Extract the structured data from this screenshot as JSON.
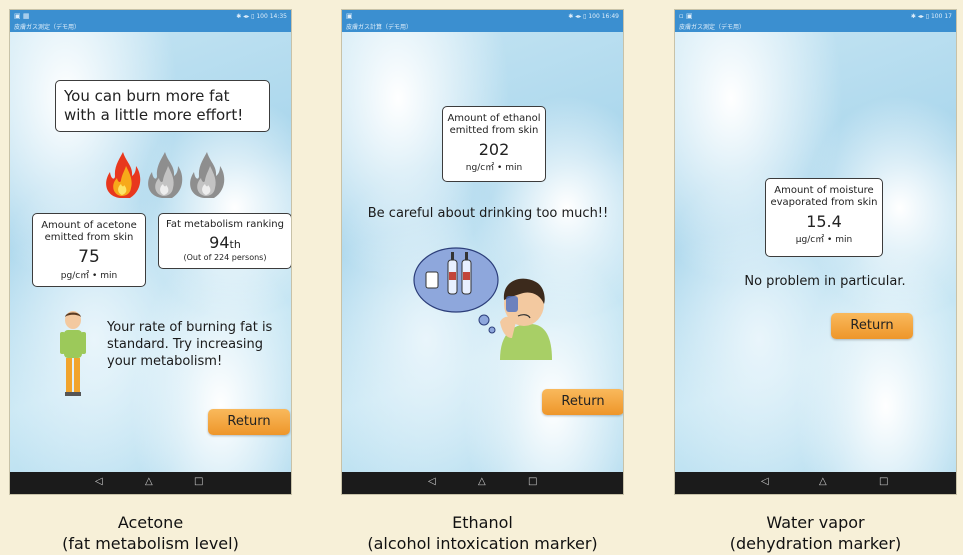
{
  "panels": [
    {
      "statusbar": {
        "time": "14:35",
        "battery": "100",
        "app_title": "皮膚ガス測定（デモ用）"
      },
      "headline": "You can burn more fat with a little more effort!",
      "acetone": {
        "label": "Amount of acetone emitted from skin",
        "value": "75",
        "unit": "pg/c㎡ • min"
      },
      "ranking": {
        "label": "Fat metabolism ranking",
        "value": "94",
        "suffix": "th",
        "note": "(Out of 224 persons)"
      },
      "message": "Your rate of burning fat is standard. Try increasing your metabolism!",
      "return_label": "Return",
      "caption_line1": "Acetone",
      "caption_line2": "(fat metabolism level)"
    },
    {
      "statusbar": {
        "time": "16:49",
        "battery": "100",
        "app_title": "皮膚ガス計算（デモ用）"
      },
      "ethanol": {
        "label": "Amount of ethanol emitted from skin",
        "value": "202",
        "unit": "ng/c㎡ • min"
      },
      "message": "Be careful about drinking too much!!",
      "return_label": "Return",
      "caption_line1": "Ethanol",
      "caption_line2": "(alcohol intoxication marker)"
    },
    {
      "statusbar": {
        "time": "17",
        "battery": "100",
        "app_title": "皮膚ガス測定（デモ用）"
      },
      "moisture": {
        "label": "Amount of moisture evaporated from skin",
        "value": "15.4",
        "unit": "μg/c㎡ • min"
      },
      "message": "No problem in particular.",
      "return_label": "Return",
      "caption_line1": "Water vapor",
      "caption_line2": "(dehydration marker)"
    }
  ],
  "nav": {
    "back": "◁",
    "home": "△",
    "recent": "□"
  },
  "colors": {
    "statusbar": "#3b8fd0",
    "button": "#f0a13a",
    "background": "#f7f0d8"
  },
  "icons": [
    "flame-icon-lit",
    "flame-icon-gray",
    "person-illustration",
    "drinking-person-illustration",
    "battery-icon",
    "wifi-icon"
  ]
}
